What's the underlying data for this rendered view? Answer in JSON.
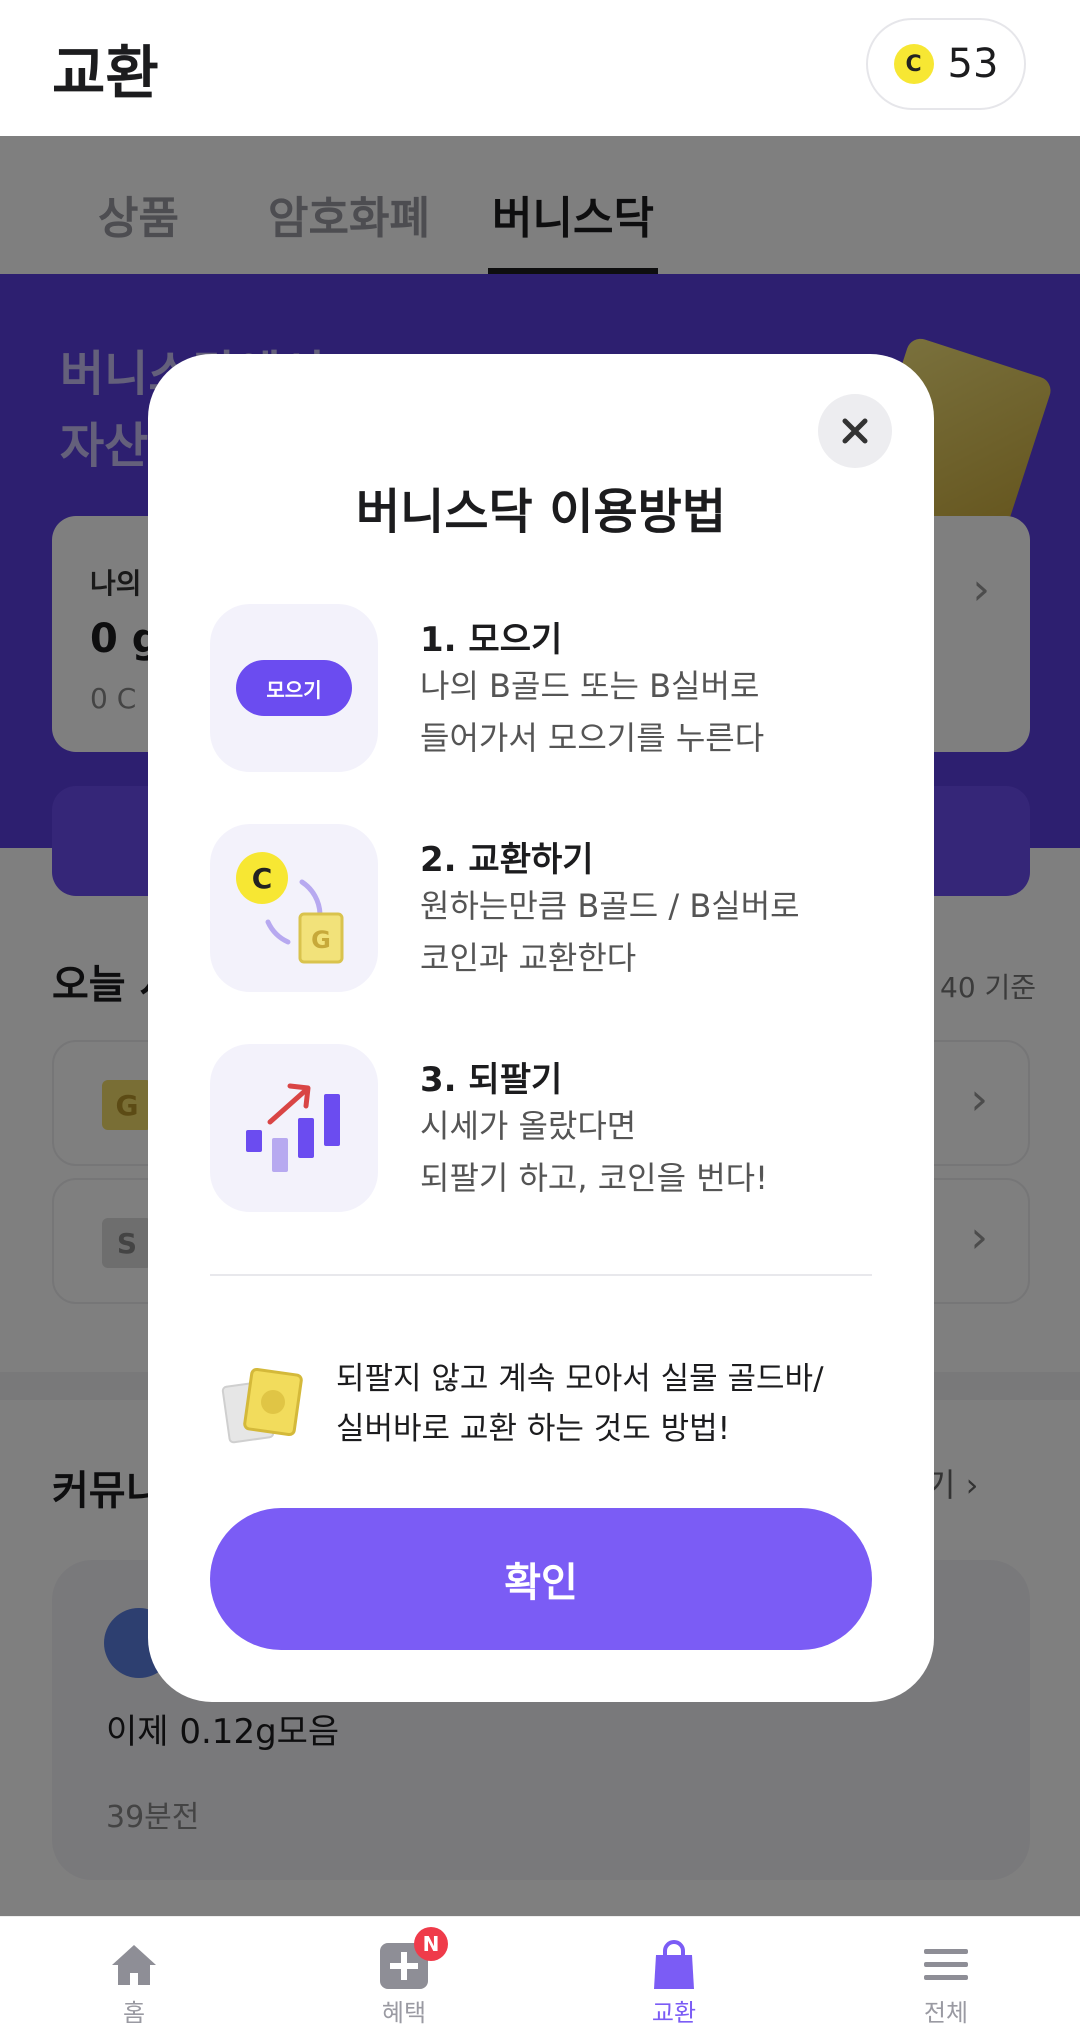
{
  "header": {
    "title": "교환",
    "coin_symbol": "C",
    "coin_count": "53"
  },
  "tabs": [
    {
      "label": "상품",
      "active": false
    },
    {
      "label": "암호화폐",
      "active": false
    },
    {
      "label": "버니스닥",
      "active": true
    }
  ],
  "hero": {
    "headline_line1": "버니스닥에서",
    "headline_line2": "자산을",
    "asset_label": "나의",
    "asset_value": "0 g",
    "asset_sub": "0 C"
  },
  "today": {
    "title": "오늘 시세",
    "note": "40 기준",
    "rows": [
      {
        "badge": "G"
      },
      {
        "badge": "S"
      }
    ]
  },
  "community": {
    "title": "커뮤니티",
    "more": "기",
    "post_text": "이제 0.12g모음",
    "post_time": "39분전"
  },
  "modal": {
    "title": "버니스닥 이용방법",
    "steps": [
      {
        "title": "1. 모으기",
        "desc_line1": "나의 B골드 또는 B실버로",
        "desc_line2": "들어가서 모으기를 누른다",
        "icon": "collect-button-icon",
        "icon_label": "모으기"
      },
      {
        "title": "2. 교환하기",
        "desc_line1": "원하는만큼 B골드 / B실버로",
        "desc_line2": "코인과 교환한다",
        "icon": "exchange-icon",
        "coin_letter": "C",
        "gold_letter": "G"
      },
      {
        "title": "3. 되팔기",
        "desc_line1": "시세가 올랐다면",
        "desc_line2": "되팔기 하고, 코인을 번다!",
        "icon": "rising-chart-icon"
      }
    ],
    "tip_line1": "되팔지 않고 계속 모아서 실물 골드바/",
    "tip_line2": "실버바로 교환 하는 것도 방법!",
    "confirm_label": "확인"
  },
  "nav": [
    {
      "label": "홈",
      "icon": "home-icon",
      "active": false
    },
    {
      "label": "혜택",
      "icon": "plus-box-icon",
      "badge": "N",
      "active": false
    },
    {
      "label": "교환",
      "icon": "shopping-bag-icon",
      "active": true
    },
    {
      "label": "전체",
      "icon": "menu-icon",
      "active": false
    }
  ],
  "colors": {
    "accent": "#7b5cf5",
    "hero_bg": "#5a3ee0",
    "badge_red": "#ef3b4a",
    "coin_yellow": "#f7e733"
  }
}
